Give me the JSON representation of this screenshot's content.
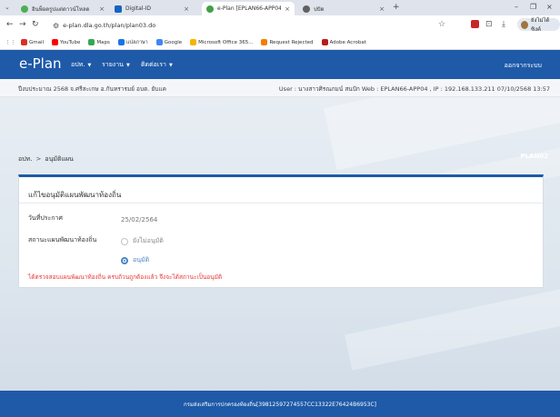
{
  "browser": {
    "tabs": [
      {
        "label": "อินพ็อตรูปแต่ดาวน์โหลด",
        "color": "#4caf50",
        "active": false
      },
      {
        "label": "Digital-ID",
        "color": "#1565c0",
        "active": false
      },
      {
        "label": "e-Plan [EPLAN66-APP04]",
        "color": "#43a047",
        "active": true
      },
      {
        "label": "ปปัด",
        "color": "#616161",
        "active": false
      }
    ],
    "url": "e-plan.dla.go.th/plan/plan03.do",
    "profile_label": "ยังไม่ได้ซิงค์",
    "bookmarks": [
      {
        "label": "Gmail",
        "color": "#d93025"
      },
      {
        "label": "YouTube",
        "color": "#ff0000"
      },
      {
        "label": "Maps",
        "color": "#34a853"
      },
      {
        "label": "แปลภาษา",
        "color": "#1a73e8"
      },
      {
        "label": "Google",
        "color": "#4285f4"
      },
      {
        "label": "Microsoft Office 365...",
        "color": "#f4b400"
      },
      {
        "label": "Request Rejected",
        "color": "#f57c00"
      },
      {
        "label": "Adobe Acrobat",
        "color": "#b71c1c"
      }
    ]
  },
  "app": {
    "logo": "e-Plan",
    "menu": [
      {
        "label": "อปท."
      },
      {
        "label": "รายงาน"
      },
      {
        "label": "ติดต่อเรา"
      }
    ],
    "logout": "ออกจากระบบ",
    "info_left": "ปีงบประมาณ 2568 จ.ศรีสะเกษ อ.กันทรารมย์ อบต. ยับแค",
    "info_right": "User : นางสาวศิรณภมน์ สนปัก  Web : EPLAN66-APP04 , IP : 192.168.133.211 07/10/2568 13:57",
    "breadcrumb": {
      "root": "อปท.",
      "current": "อนุมัติแผน"
    },
    "page_code": "PLAN02",
    "panel": {
      "title": "แก้ไขอนุมัติแผนพัฒนาท้องถิ่น",
      "date_label": "วันที่ประกาศ",
      "date_value": "25/02/2564",
      "status_label": "สถานะแผนพัฒนาท้องถิ่น",
      "status_options": [
        {
          "label": "ยังไม่อนุมัติ",
          "checked": false
        },
        {
          "label": "อนุมัติ",
          "checked": true
        }
      ],
      "alert": "ได้ตรวจสอบแผนพัฒนาท้องถิ่น ครบถ้วนถูกต้องแล้ว จึงจะได้สถานะเป็นอนุมัติ"
    },
    "footer": "กรมส่งเสริมการปกครองท้องถิ่น[39812597274557CC13322E76424B6953C]"
  }
}
